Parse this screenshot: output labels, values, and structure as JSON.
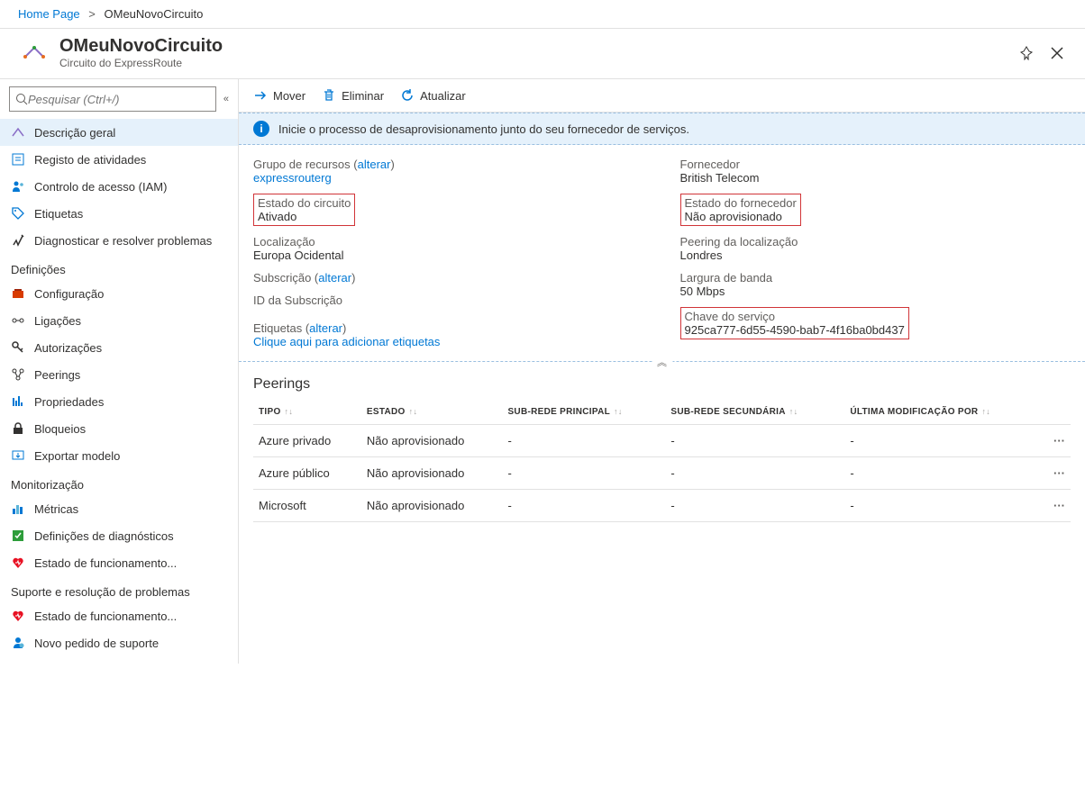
{
  "breadcrumb": {
    "home": "Home Page",
    "current": "OMeuNovoCircuito"
  },
  "header": {
    "title": "OMeuNovoCircuito",
    "subtitle": "Circuito do ExpressRoute"
  },
  "search": {
    "placeholder": "Pesquisar (Ctrl+/)"
  },
  "nav": {
    "items": [
      {
        "label": "Descrição geral"
      },
      {
        "label": "Registo de atividades"
      },
      {
        "label": "Controlo de acesso (IAM)"
      },
      {
        "label": "Etiquetas"
      },
      {
        "label": "Diagnosticar e resolver problemas"
      }
    ],
    "settings_header": "Definições",
    "settings": [
      {
        "label": "Configuração"
      },
      {
        "label": "Ligações"
      },
      {
        "label": "Autorizações"
      },
      {
        "label": "Peerings"
      },
      {
        "label": "Propriedades"
      },
      {
        "label": "Bloqueios"
      },
      {
        "label": "Exportar modelo"
      }
    ],
    "monitoring_header": "Monitorização",
    "monitoring": [
      {
        "label": "Métricas"
      },
      {
        "label": "Definições de diagnósticos"
      },
      {
        "label": "Estado de funcionamento..."
      }
    ],
    "support_header": "Suporte e resolução de problemas",
    "support": [
      {
        "label": "Estado de funcionamento..."
      },
      {
        "label": "Novo pedido de suporte"
      }
    ]
  },
  "toolbar": {
    "move": "Mover",
    "delete": "Eliminar",
    "refresh": "Atualizar"
  },
  "infobar": {
    "text": "Inicie o processo de desaprovisionamento junto do seu fornecedor de serviços."
  },
  "props": {
    "change": "alterar",
    "left": {
      "rg_label": "Grupo de recursos",
      "rg_value": "expressrouterg",
      "state_label": "Estado do circuito",
      "state_value": "Ativado",
      "loc_label": "Localização",
      "loc_value": "Europa Ocidental",
      "sub_label": "Subscrição",
      "subid_label": "ID da Subscrição",
      "tags_label": "Etiquetas",
      "tags_link": "Clique aqui para adicionar etiquetas"
    },
    "right": {
      "prov_label": "Fornecedor",
      "prov_value": "British Telecom",
      "pstate_label": "Estado do fornecedor",
      "pstate_value": "Não aprovisionado",
      "peerloc_label": "Peering da localização",
      "peerloc_value": "Londres",
      "bw_label": "Largura de banda",
      "bw_value": "50 Mbps",
      "skey_label": "Chave do serviço",
      "skey_value": "925ca777-6d55-4590-bab7-4f16ba0bd437"
    }
  },
  "peerings": {
    "title": "Peerings",
    "cols": {
      "type": "TIPO",
      "state": "ESTADO",
      "primary": "SUB-REDE PRINCIPAL",
      "secondary": "SUB-REDE SECUNDÁRIA",
      "lastmod": "ÚLTIMA MODIFICAÇÃO POR"
    },
    "rows": [
      {
        "type": "Azure privado",
        "state": "Não aprovisionado",
        "primary": "-",
        "secondary": "-",
        "lastmod": "-"
      },
      {
        "type": "Azure público",
        "state": "Não aprovisionado",
        "primary": "-",
        "secondary": "-",
        "lastmod": "-"
      },
      {
        "type": "Microsoft",
        "state": "Não aprovisionado",
        "primary": "-",
        "secondary": "-",
        "lastmod": "-"
      }
    ]
  }
}
